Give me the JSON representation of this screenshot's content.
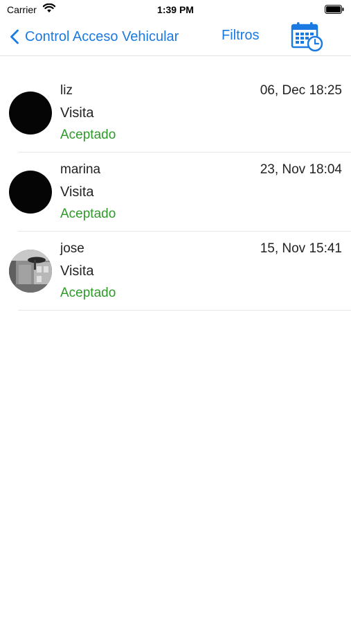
{
  "status_bar": {
    "carrier": "Carrier",
    "time": "1:39 PM"
  },
  "nav": {
    "back_label": "Control Acceso Vehicular",
    "filters_label": "Filtros",
    "calendar_icon": "calendar-clock-icon",
    "accent_color": "#1a7ae2"
  },
  "entries": [
    {
      "name": "liz",
      "type": "Visita",
      "status": "Aceptado",
      "date": "06, Dec 18:25",
      "avatar": "black-circle"
    },
    {
      "name": "marina",
      "type": "Visita",
      "status": "Aceptado",
      "date": "23, Nov 18:04",
      "avatar": "black-circle"
    },
    {
      "name": "jose",
      "type": "Visita",
      "status": "Aceptado",
      "date": "15, Nov 15:41",
      "avatar": "photo"
    }
  ],
  "status_color": "#2e9a2a"
}
